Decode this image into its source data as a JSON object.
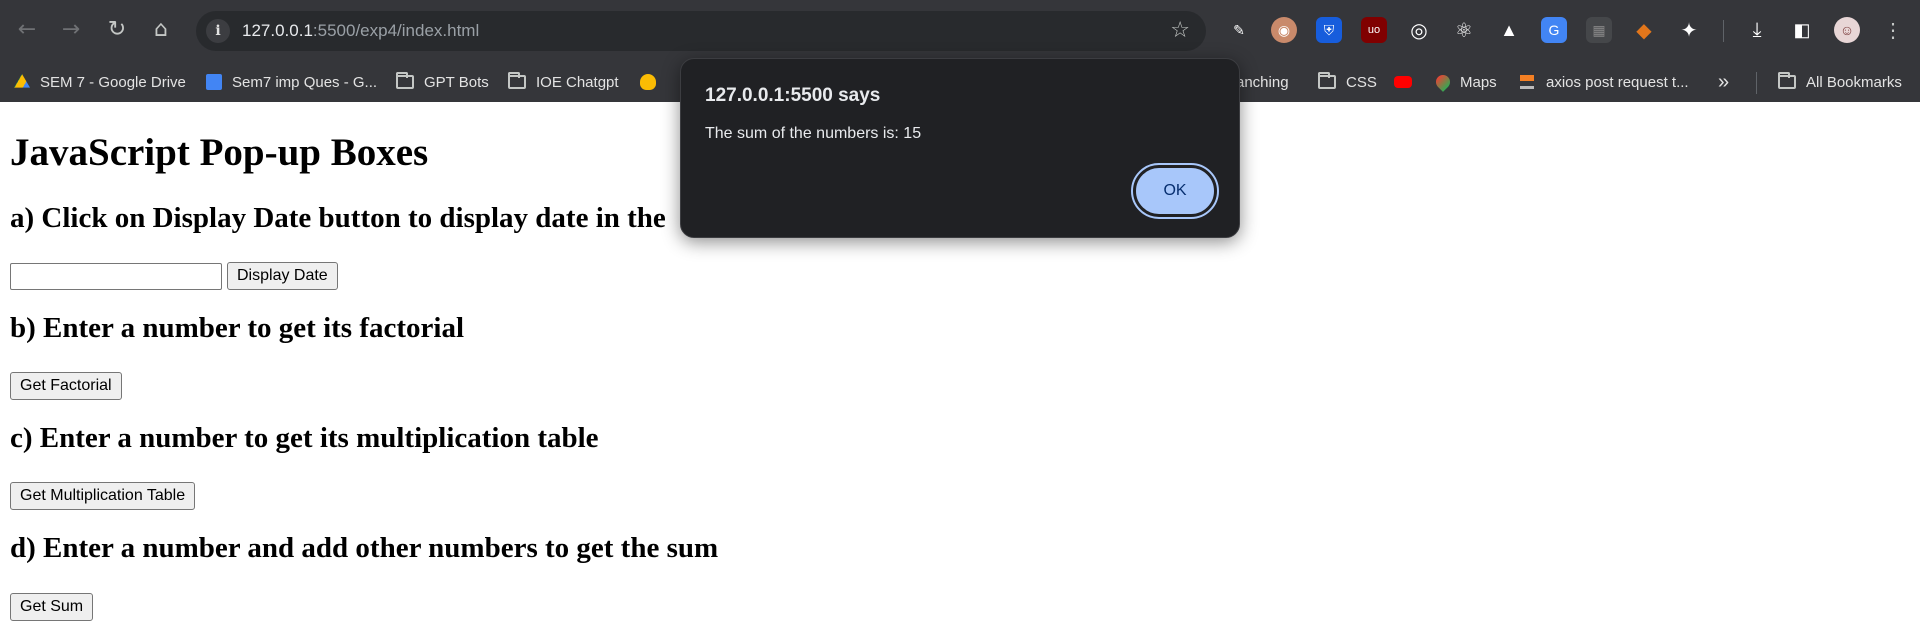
{
  "browser": {
    "url_host": "127.0.0.1",
    "url_path": ":5500/exp4/index.html",
    "icons": {
      "back": "←",
      "forward": "→",
      "reload": "↻",
      "home": "⌂",
      "site_info": "i",
      "bookmark": "☆",
      "menu": "⋮",
      "more_bookmarks": "»"
    },
    "extensions": [
      {
        "name": "eyedropper",
        "glyph": "✎",
        "color": "#35363a"
      },
      {
        "name": "owl",
        "glyph": "◉",
        "color": "#c98a6b"
      },
      {
        "name": "bitwarden",
        "glyph": "⛨",
        "color": "#175ddc"
      },
      {
        "name": "ublock",
        "glyph": "uo",
        "color": "#800000"
      },
      {
        "name": "target",
        "glyph": "◎",
        "color": "#35363a"
      },
      {
        "name": "react-devtools",
        "glyph": "⚛",
        "color": "#35363a"
      },
      {
        "name": "hat",
        "glyph": "▲",
        "color": "#35363a"
      },
      {
        "name": "translate",
        "glyph": "G",
        "color": "#4285f4"
      },
      {
        "name": "grid",
        "glyph": "▦",
        "color": "#45474a"
      },
      {
        "name": "metamask",
        "glyph": "◆",
        "color": "#e2761b"
      },
      {
        "name": "puzzle",
        "glyph": "✦",
        "color": "#35363a"
      }
    ]
  },
  "bookmarks": [
    {
      "label": "SEM 7 - Google Drive",
      "icon": "drive"
    },
    {
      "label": "Sem7 imp Ques - G...",
      "icon": "docs"
    },
    {
      "label": "GPT Bots",
      "icon": "folder"
    },
    {
      "label": "IOE Chatgpt",
      "icon": "folder"
    },
    {
      "label": "",
      "icon": "linux"
    },
    {
      "label": "anching",
      "icon": "none"
    },
    {
      "label": "CSS",
      "icon": "folder"
    },
    {
      "label": "",
      "icon": "youtube"
    },
    {
      "label": "Maps",
      "icon": "maps"
    },
    {
      "label": "axios post request t...",
      "icon": "stackoverflow"
    },
    {
      "label": "All Bookmarks",
      "icon": "folder"
    }
  ],
  "page": {
    "heading": "JavaScript Pop-up Boxes",
    "section_a": "a) Click on Display Date button to display date in the",
    "section_b": "b) Enter a number to get its factorial",
    "section_c": "c) Enter a number to get its multiplication table",
    "section_d": "d) Enter a number and add other numbers to get the sum",
    "date_input_value": "",
    "display_date_button": "Display Date",
    "factorial_button": "Get Factorial",
    "table_button": "Get Multiplication Table",
    "sum_button": "Get Sum"
  },
  "dialog": {
    "title": "127.0.0.1:5500 says",
    "message": "The sum of the numbers is: 15",
    "ok_label": "OK"
  },
  "colors": {
    "chrome_bg": "#35363a",
    "omnibox_bg": "#282a2d",
    "dialog_bg": "#202124",
    "ok_button": "#a8c7fa"
  }
}
